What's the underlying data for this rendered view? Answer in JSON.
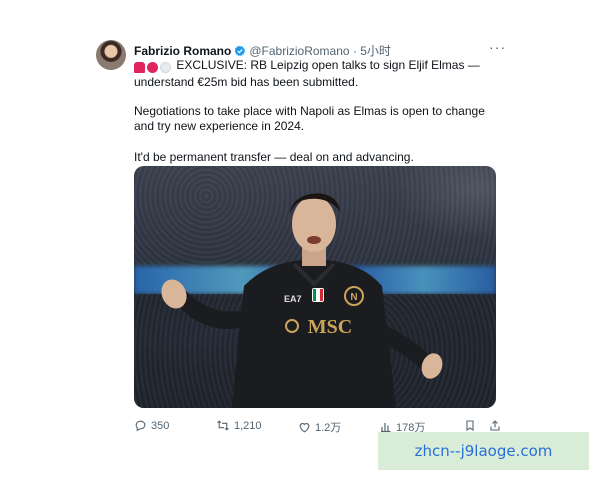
{
  "tweet": {
    "author_name": "Fabrizio Romano",
    "handle": "@FabrizioRomano",
    "separator": "·",
    "time": "5小时",
    "more": "···",
    "emojis": [
      "siren-emoji",
      "red-circle-emoji",
      "white-circle-emoji"
    ],
    "line1": "EXCLUSIVE: RB Leipzig open talks to sign Eljif Elmas — understand €25m bid has been submitted.",
    "line2": "Negotiations to take place with Napoli as Elmas is open to change and try new experience in 2024.",
    "line3": "It'd be permanent transfer — deal on and advancing.",
    "media": {
      "jersey_sponsor": "MSC",
      "kit_brand": "EA7",
      "colors": {
        "jersey": "#1b1c1f",
        "sponsor_gold": "#c9a45a",
        "led_blue": "#3f8fd0"
      }
    },
    "actions": {
      "replies": "350",
      "retweets": "1,210",
      "likes": "1.2万",
      "views": "178万"
    }
  },
  "watermark": {
    "text": "zhcn--j9laoge.com"
  },
  "colors": {
    "text": "#0f1419",
    "muted": "#536471",
    "verified": "#1d9bf0",
    "watermark_bg": "#d8ecd8",
    "watermark_text": "#2a6fd6"
  }
}
